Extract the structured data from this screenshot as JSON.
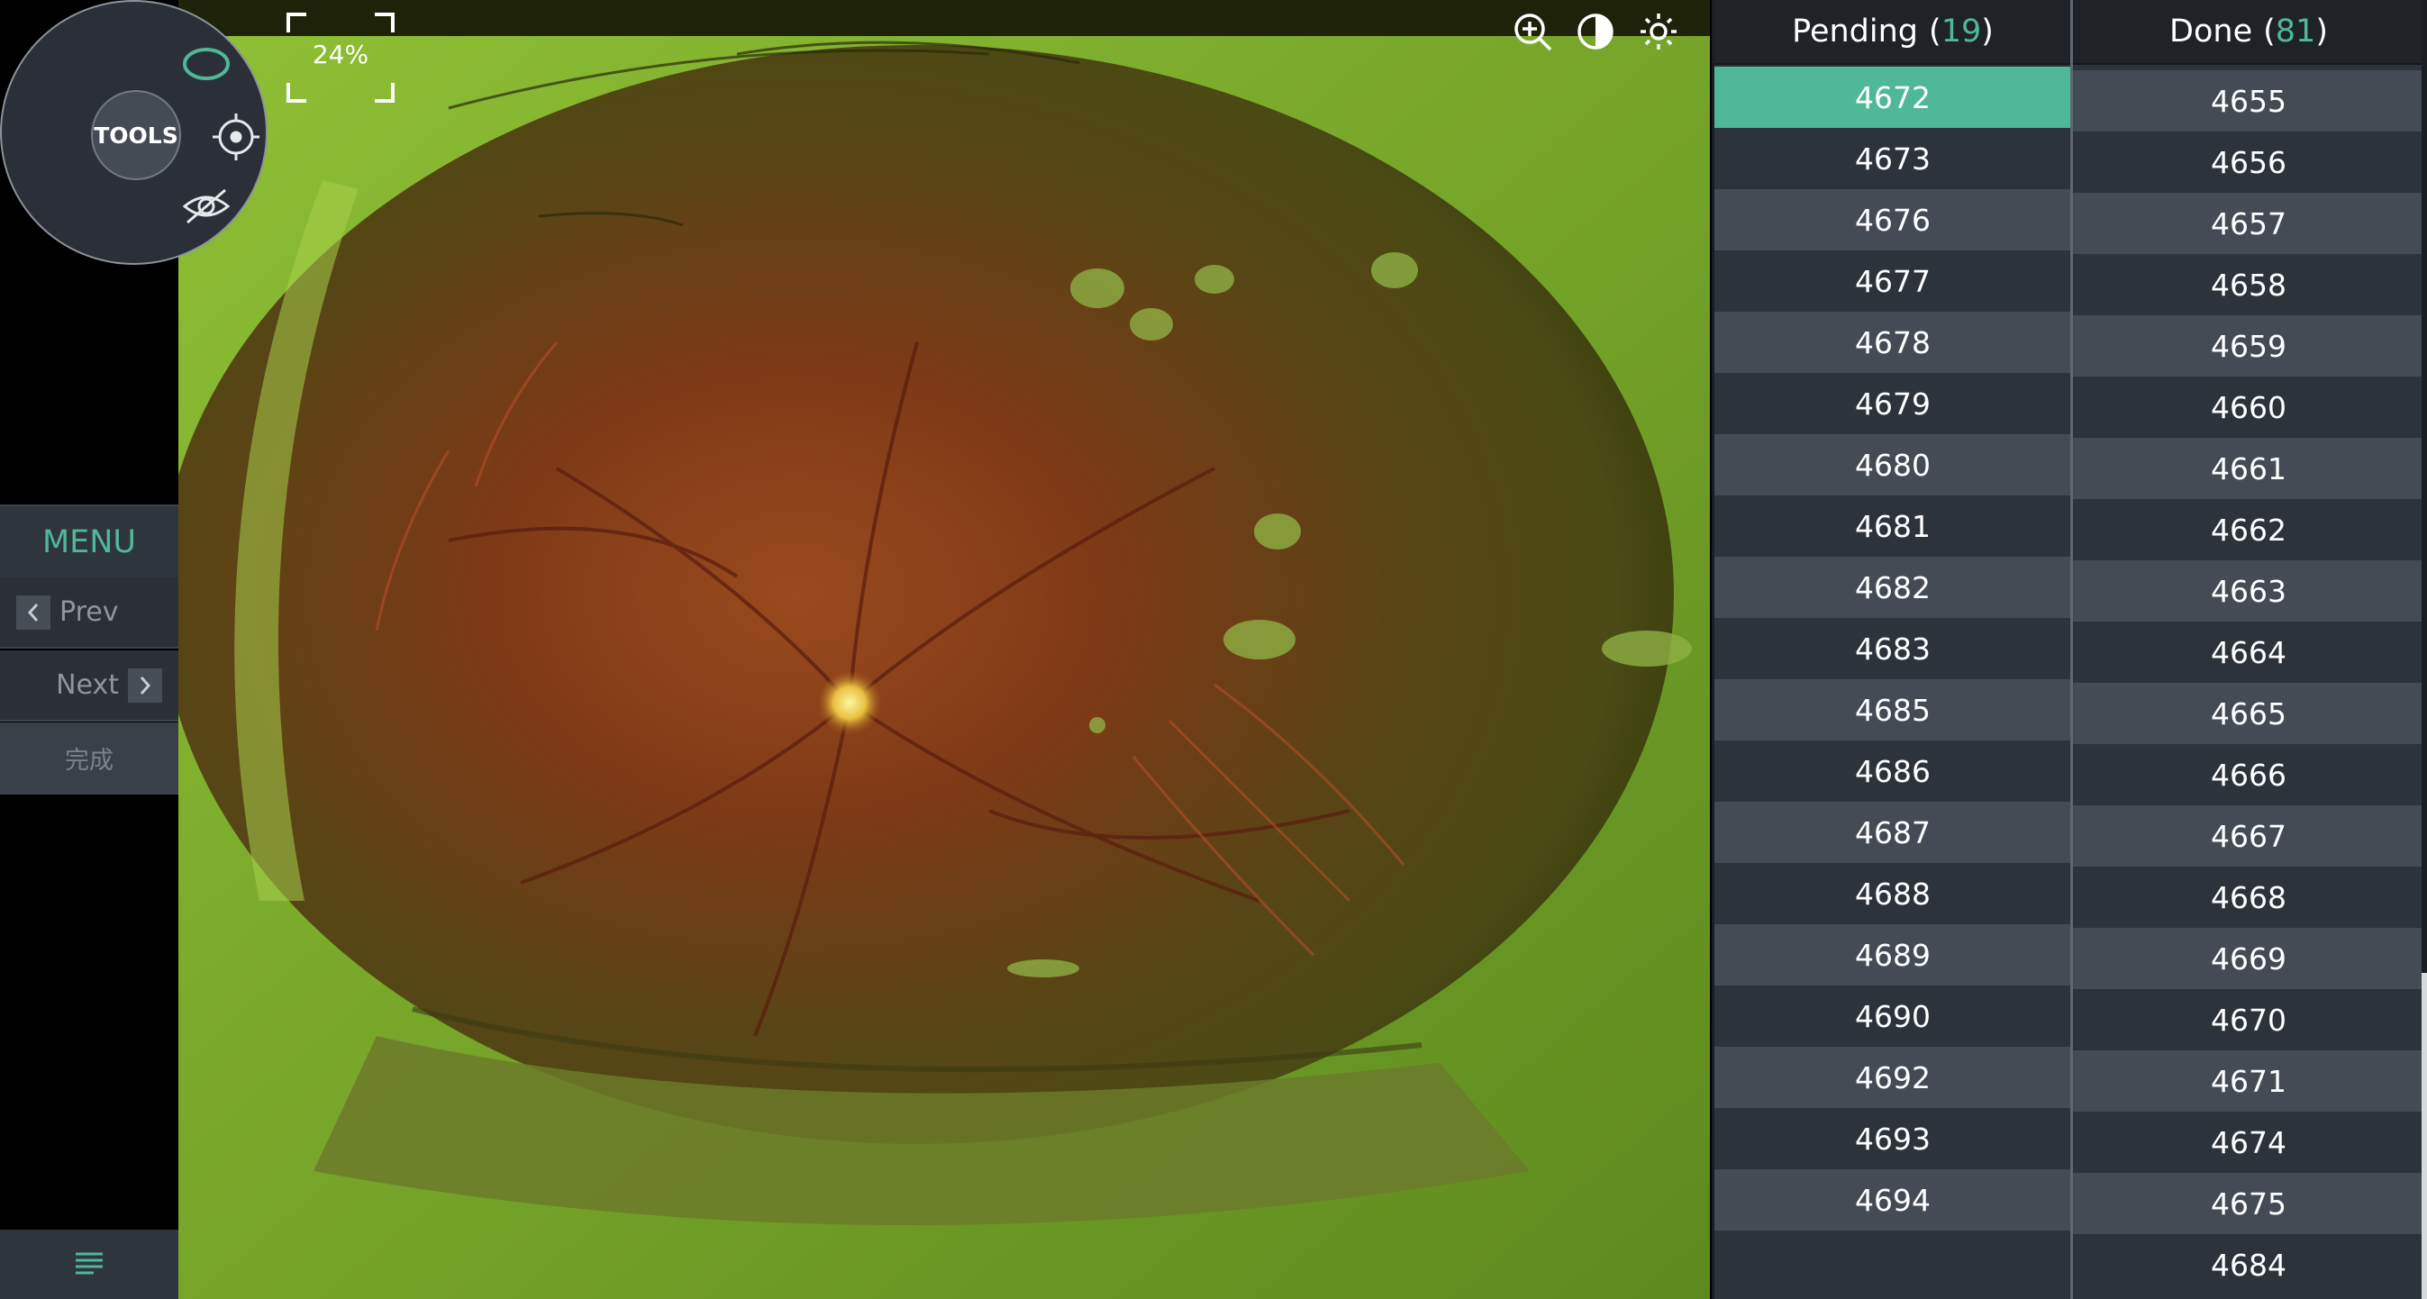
{
  "tools": {
    "label": "TOOLS"
  },
  "zoom": {
    "value": "24%"
  },
  "menu": {
    "title": "MENU",
    "prev_label": "Prev",
    "next_label": "Next",
    "complete_label": "完成"
  },
  "pending": {
    "title": "Pending",
    "count": "19",
    "items": [
      "4672",
      "4673",
      "4676",
      "4677",
      "4678",
      "4679",
      "4680",
      "4681",
      "4682",
      "4683",
      "4685",
      "4686",
      "4687",
      "4688",
      "4689",
      "4690",
      "4692",
      "4693",
      "4694"
    ],
    "selected": "4672"
  },
  "done": {
    "title": "Done",
    "count": "81",
    "items": [
      "4655",
      "4656",
      "4657",
      "4658",
      "4659",
      "4660",
      "4661",
      "4662",
      "4663",
      "4664",
      "4665",
      "4666",
      "4667",
      "4668",
      "4669",
      "4670",
      "4671",
      "4674",
      "4675",
      "4684"
    ]
  },
  "icons": {
    "ellipse_tool": "ellipse-icon",
    "crosshair_tool": "crosshair-icon",
    "hide_tool": "eye-slash-icon",
    "zoom_in": "zoom-in-icon",
    "contrast": "contrast-icon",
    "brightness": "brightness-icon",
    "menu_list": "menu-list-icon"
  },
  "colors": {
    "accent": "#4fb896",
    "panel": "#2d333b",
    "panel_alt": "#454b55"
  }
}
